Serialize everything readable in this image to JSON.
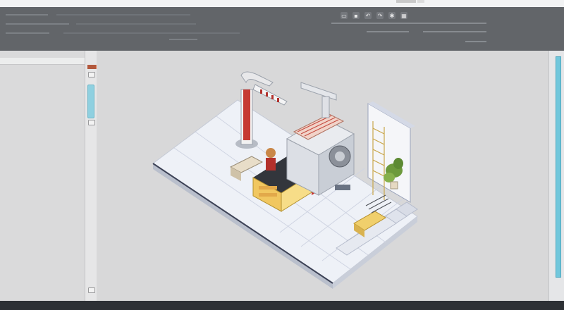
{
  "window": {
    "title": "",
    "colors": {
      "accent": "#e07b55",
      "selection": "#71c7dc",
      "toolbar": "#626569",
      "viewport": "#d8d8d9"
    }
  },
  "toolbar": {
    "row1": [
      "",
      "",
      "",
      ""
    ],
    "row2": [
      "",
      "",
      ""
    ],
    "icons": [
      "folder-icon",
      "save-icon",
      "undo-icon",
      "redo-icon",
      "settings-icon",
      "grid-icon"
    ]
  },
  "left_panel": {
    "header": ""
  },
  "viewport": {
    "scene": "isometric-machine-room",
    "objects": [
      "robotic-arm",
      "control-console",
      "press-machine",
      "storage-rack",
      "potted-plant",
      "floor-platform"
    ]
  },
  "status": {
    "view_label": ""
  }
}
